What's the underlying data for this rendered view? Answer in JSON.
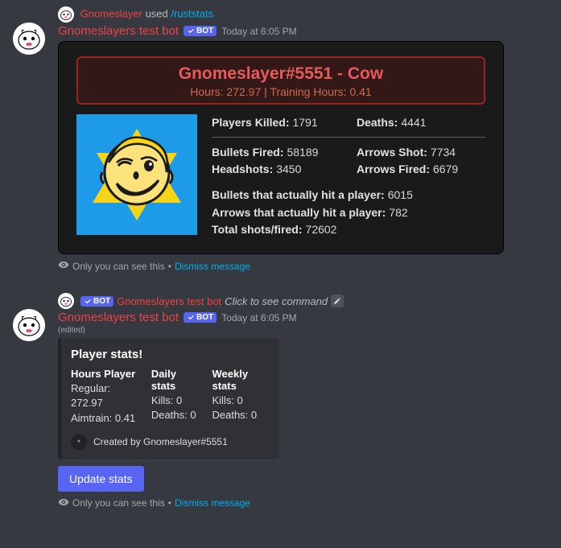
{
  "msg1": {
    "command_user": "Gnomeslayer",
    "used_word": "used",
    "command": "/ruststats",
    "bot_name": "Gnomeslayers test bot",
    "bot_tag": "BOT",
    "timestamp": "Today at 6:05 PM",
    "embed": {
      "title": "Gnomeslayer#5551 - Cow",
      "subtitle": "Hours: 272.97 | Training Hours: 0.41",
      "players_killed_label": "Players Killed:",
      "players_killed": "1791",
      "deaths_label": "Deaths:",
      "deaths": "4441",
      "bullets_fired_label": "Bullets Fired:",
      "bullets_fired": "58189",
      "arrows_shot_label": "Arrows Shot:",
      "arrows_shot": "7734",
      "headshots_label": "Headshots:",
      "headshots": "3450",
      "arrows_fired_label": "Arrows Fired:",
      "arrows_fired": "6679",
      "bullets_hit_label": "Bullets that actually hit a player:",
      "bullets_hit": "6015",
      "arrows_hit_label": "Arrows that actually hit a player:",
      "arrows_hit": "782",
      "total_shots_label": "Total shots/fired:",
      "total_shots": "72602"
    },
    "ephemeral_text": "Only you can see this",
    "dismiss": "Dismiss message",
    "dot": "•"
  },
  "msg2": {
    "ref_bot": "Gnomeslayers test bot",
    "ref_tag": "BOT",
    "ref_click": "Click to see command",
    "bot_name": "Gnomeslayers test bot",
    "bot_tag": "BOT",
    "timestamp": "Today at 6:05 PM",
    "edited": "(edited)",
    "embed": {
      "title": "Player stats!",
      "f1_title": "Hours Player",
      "f1_body1": "Regular: 272.97",
      "f1_body2": "Aimtrain: 0.41",
      "f2_title": "Daily stats",
      "f2_body1": "Kills: 0",
      "f2_body2": "Deaths: 0",
      "f3_title": "Weekly stats",
      "f3_body1": "Kills: 0",
      "f3_body2": "Deaths: 0",
      "footer": "Created by Gnomeslayer#5551"
    },
    "button": "Update stats",
    "ephemeral_text": "Only you can see this",
    "dismiss": "Dismiss message",
    "dot": "•"
  }
}
